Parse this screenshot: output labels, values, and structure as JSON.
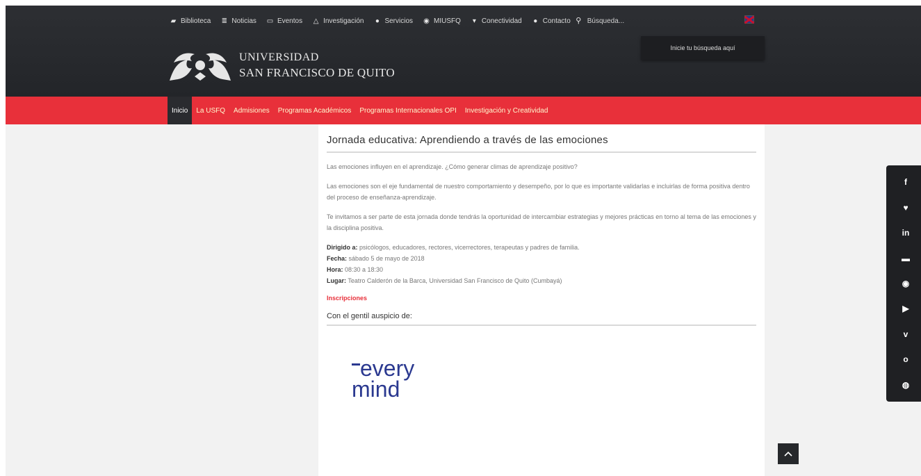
{
  "topnav": {
    "items": [
      {
        "label": "Biblioteca",
        "icon": "book-icon"
      },
      {
        "label": "Noticias",
        "icon": "news-icon"
      },
      {
        "label": "Eventos",
        "icon": "calendar-icon"
      },
      {
        "label": "Investigación",
        "icon": "flask-icon"
      },
      {
        "label": "Servicios",
        "icon": "info-icon"
      },
      {
        "label": "MIUSFQ",
        "icon": "user-circle-icon"
      },
      {
        "label": "Conectividad",
        "icon": "wifi-icon"
      },
      {
        "label": "Contacto",
        "icon": "chat-icon"
      }
    ],
    "search_label": "Búsqueda...",
    "search_tooltip": "Inicie tu búsqueda aquí"
  },
  "logo": {
    "line1": "UNIVERSIDAD",
    "line2": "SAN FRANCISCO DE QUITO"
  },
  "mainnav": {
    "items": [
      "Inicio",
      "La USFQ",
      "Admisiones",
      "Programas Académicos",
      "Programas Internacionales OPI",
      "Investigación y Creatividad"
    ]
  },
  "article": {
    "title": "Jornada educativa: Aprendiendo a través de las emociones",
    "p1": "Las emociones influyen en el aprendizaje. ¿Cómo generar climas de aprendizaje positivo?",
    "p2": "Las emociones son el eje fundamental de nuestro comportamiento y desempeño, por lo que es importante validarlas e incluirlas de forma positiva dentro del proceso de enseñanza-aprendizaje.",
    "p3": "Te invitamos a ser parte de esta jornada donde tendrás la oportunidad de intercambiar estrategias y mejores prácticas en torno al tema de las emociones y la disciplina positiva.",
    "dirigido_label": "Dirigido a:",
    "dirigido_value": " psicólogos, educadores, rectores, vicerrectores, terapeutas y padres de familia.",
    "fecha_label": "Fecha:",
    "fecha_value": " sábado 5 de mayo de 2018",
    "hora_label": "Hora:",
    "hora_value": " 08:30 a 18:30",
    "lugar_label": "Lugar:",
    "lugar_value": " Teatro Calderón de la Barca, Universidad San Francisco de Quito (Cumbayá)",
    "inscripciones": "Inscripciones",
    "sponsor_title": "Con el gentil auspicio de:",
    "sponsor_logo_line1": "every",
    "sponsor_logo_line2": "mind"
  },
  "social": {
    "icons": [
      "facebook-icon",
      "twitter-icon",
      "linkedin-icon",
      "flickr-icon",
      "instagram-icon",
      "youtube-icon",
      "vimeo-icon",
      "issuu-icon",
      "spotify-icon"
    ],
    "glyphs": [
      "f",
      "♥",
      "in",
      "▬",
      "◉",
      "▶",
      "v",
      "o",
      "◍"
    ]
  },
  "colors": {
    "header_dark": "#2d2f33",
    "nav_red": "#e8303a",
    "logo_blue": "#2b3990"
  }
}
